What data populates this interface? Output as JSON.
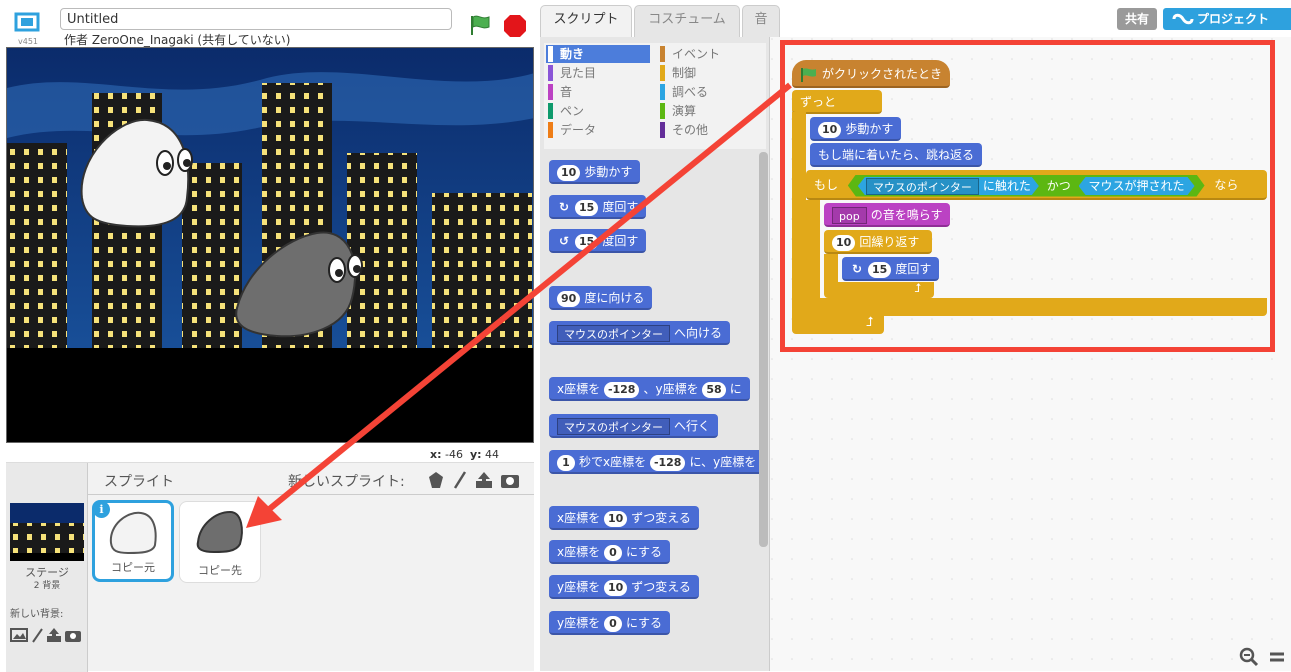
{
  "header": {
    "title_value": "Untitled",
    "author": "作者 ZeroOne_Inagaki (共有していない)",
    "version": "v451"
  },
  "stage": {
    "mouse_x_label": "x:",
    "mouse_x": "-46",
    "mouse_y_label": "y:",
    "mouse_y": "44"
  },
  "tabs": {
    "scripts": "スクリプト",
    "costumes": "コスチューム",
    "sounds": "音"
  },
  "top_right": {
    "share": "共有",
    "remix": "プロジェクト"
  },
  "sprite_pane": {
    "sprites_label": "スプライト",
    "new_sprite_label": "新しいスプライト:",
    "stage_name": "ステージ",
    "stage_count": "2 背景",
    "new_background_label": "新しい背景:",
    "sprites": [
      {
        "name": "コピー元",
        "selected": true
      },
      {
        "name": "コピー先",
        "selected": false
      }
    ]
  },
  "categories": [
    {
      "label": "動き",
      "color": "#4a6cd4",
      "active": true
    },
    {
      "label": "見た目",
      "color": "#8a55d7"
    },
    {
      "label": "音",
      "color": "#bb42c3"
    },
    {
      "label": "ペン",
      "color": "#0e9a6c"
    },
    {
      "label": "データ",
      "color": "#ee7d16"
    },
    {
      "label": "イベント",
      "color": "#c88330"
    },
    {
      "label": "制御",
      "color": "#e1a91a"
    },
    {
      "label": "調べる",
      "color": "#2ca5e2"
    },
    {
      "label": "演算",
      "color": "#5cb712"
    },
    {
      "label": "その他",
      "color": "#632d99"
    }
  ],
  "palette_blocks": {
    "move": {
      "num": "10",
      "text": "歩動かす"
    },
    "turn_right": {
      "num": "15",
      "text": "度回す"
    },
    "turn_left": {
      "num": "15",
      "text": "度回す"
    },
    "point_dir": {
      "num": "90",
      "text": "度に向ける"
    },
    "point_towards": {
      "drop": "マウスのポインター",
      "text": "へ向ける"
    },
    "goto_xy": {
      "a": "x座標を",
      "x": "-128",
      "b": "、y座標を",
      "y": "58",
      "c": "に"
    },
    "goto": {
      "drop": "マウスのポインター",
      "text": "へ行く"
    },
    "glide": {
      "num": "1",
      "a": "秒でx座標を",
      "x": "-128",
      "b": "に、y座標を"
    },
    "change_x": {
      "a": "x座標を",
      "num": "10",
      "b": "ずつ変える"
    },
    "set_x": {
      "a": "x座標を",
      "num": "0",
      "b": "にする"
    },
    "change_y": {
      "a": "y座標を",
      "num": "10",
      "b": "ずつ変える"
    },
    "set_y": {
      "a": "y座標を",
      "num": "0",
      "b": "にする"
    }
  },
  "script": {
    "hat": "がクリックされたとき",
    "forever": "ずっと",
    "move": {
      "num": "10",
      "text": "歩動かす"
    },
    "bounce": "もし端に着いたら、跳ね返る",
    "if_label": "もし",
    "touching_drop": "マウスのポインター",
    "touching_text": "に触れた",
    "and_text": "かつ",
    "mouse_down": "マウスが押された",
    "then_text": "なら",
    "play_sound": {
      "drop": "pop",
      "text": "の音を鳴らす"
    },
    "repeat": {
      "num": "10",
      "text": "回繰り返す"
    },
    "turn": {
      "num": "15",
      "text": "度回す"
    }
  }
}
